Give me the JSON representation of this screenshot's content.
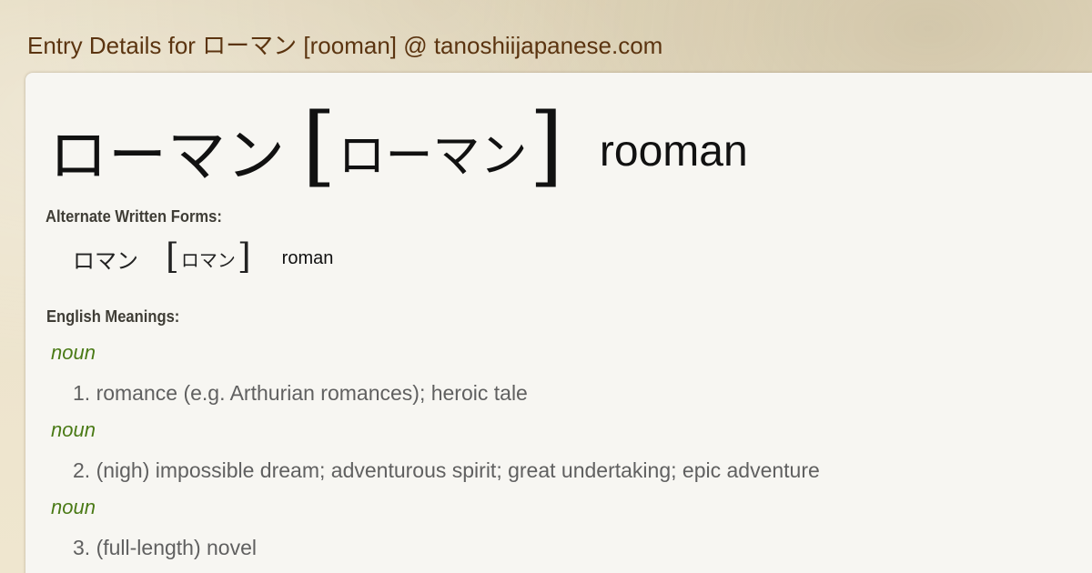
{
  "page": {
    "title": "Entry Details for ローマン [rooman] @ tanoshiijapanese.com"
  },
  "entry": {
    "kanji": "ローマン",
    "reading": "ローマン",
    "bracket_open": "[",
    "bracket_close": "]",
    "romaji": "rooman"
  },
  "alternate": {
    "label": "Alternate Written Forms:",
    "forms": [
      {
        "kanji": "ロマン",
        "reading": "ロマン",
        "romaji": "roman"
      }
    ]
  },
  "meanings": {
    "label": "English Meanings:",
    "items": [
      {
        "pos": "noun",
        "text": "1. romance (e.g. Arthurian romances); heroic tale"
      },
      {
        "pos": "noun",
        "text": "2. (nigh) impossible dream; adventurous spirit; great undertaking; epic adventure"
      },
      {
        "pos": "noun",
        "text": "3. (full-length) novel"
      }
    ]
  },
  "colors": {
    "title": "#5b3410",
    "pos": "#4a7a16",
    "meaning": "#606060",
    "card": "#f7f6f2"
  }
}
